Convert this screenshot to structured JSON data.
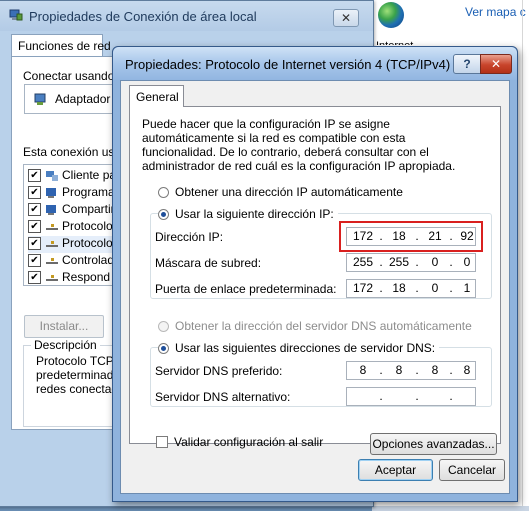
{
  "background_window": {
    "title": "Propiedades de Conexión de área local",
    "close_label": "✕",
    "tab_label": "Funciones de red",
    "connect_using_label": "Conectar usando:",
    "adapter_name": "Adaptador d",
    "items_label": "Esta conexión usa",
    "items": [
      {
        "label": "Cliente pa",
        "checked": true
      },
      {
        "label": "Programa",
        "checked": true
      },
      {
        "label": "Compartir",
        "checked": true
      },
      {
        "label": "Protocolo",
        "checked": true
      },
      {
        "label": "Protocolo",
        "checked": true
      },
      {
        "label": "Controlad",
        "checked": true
      },
      {
        "label": "Respond",
        "checked": true
      }
    ],
    "install_label": "Instalar...",
    "description_title": "Descripción",
    "description_text": [
      "Protocolo TCP/",
      "predeterminado",
      "redes conectad"
    ]
  },
  "background_right": {
    "link_text": "Ver mapa c",
    "stub_text": "Internet"
  },
  "dialog": {
    "title": "Propiedades: Protocolo de Internet versión 4 (TCP/IPv4)",
    "help_label": "?",
    "close_label": "✕",
    "tab_label": "General",
    "intro": "Puede hacer que la configuración IP se asigne automáticamente si la red es compatible con esta funcionalidad. De lo contrario, deberá consultar con el administrador de red cuál es la configuración IP apropiada.",
    "ip_auto_label": "Obtener una dirección IP automáticamente",
    "ip_manual_label": "Usar la siguiente dirección IP:",
    "ip_mode": "manual",
    "ip_address_label": "Dirección IP:",
    "ip_address": [
      "172",
      "18",
      "21",
      "92"
    ],
    "subnet_label": "Máscara de subred:",
    "subnet": [
      "255",
      "255",
      "0",
      "0"
    ],
    "gateway_label": "Puerta de enlace predeterminada:",
    "gateway": [
      "172",
      "18",
      "0",
      "1"
    ],
    "dns_auto_label": "Obtener la dirección del servidor DNS automáticamente",
    "dns_manual_label": "Usar las siguientes direcciones de servidor DNS:",
    "dns_mode": "manual",
    "dns_preferred_label": "Servidor DNS preferido:",
    "dns_preferred": [
      "8",
      "8",
      "8",
      "8"
    ],
    "dns_alternate_label": "Servidor DNS alternativo:",
    "dns_alternate": [
      "",
      "",
      "",
      ""
    ],
    "validate_label": "Validar configuración al salir",
    "validate_checked": false,
    "advanced_label": "Opciones avanzadas...",
    "ok_label": "Aceptar",
    "cancel_label": "Cancelar",
    "highlight_color": "#d9201f"
  }
}
